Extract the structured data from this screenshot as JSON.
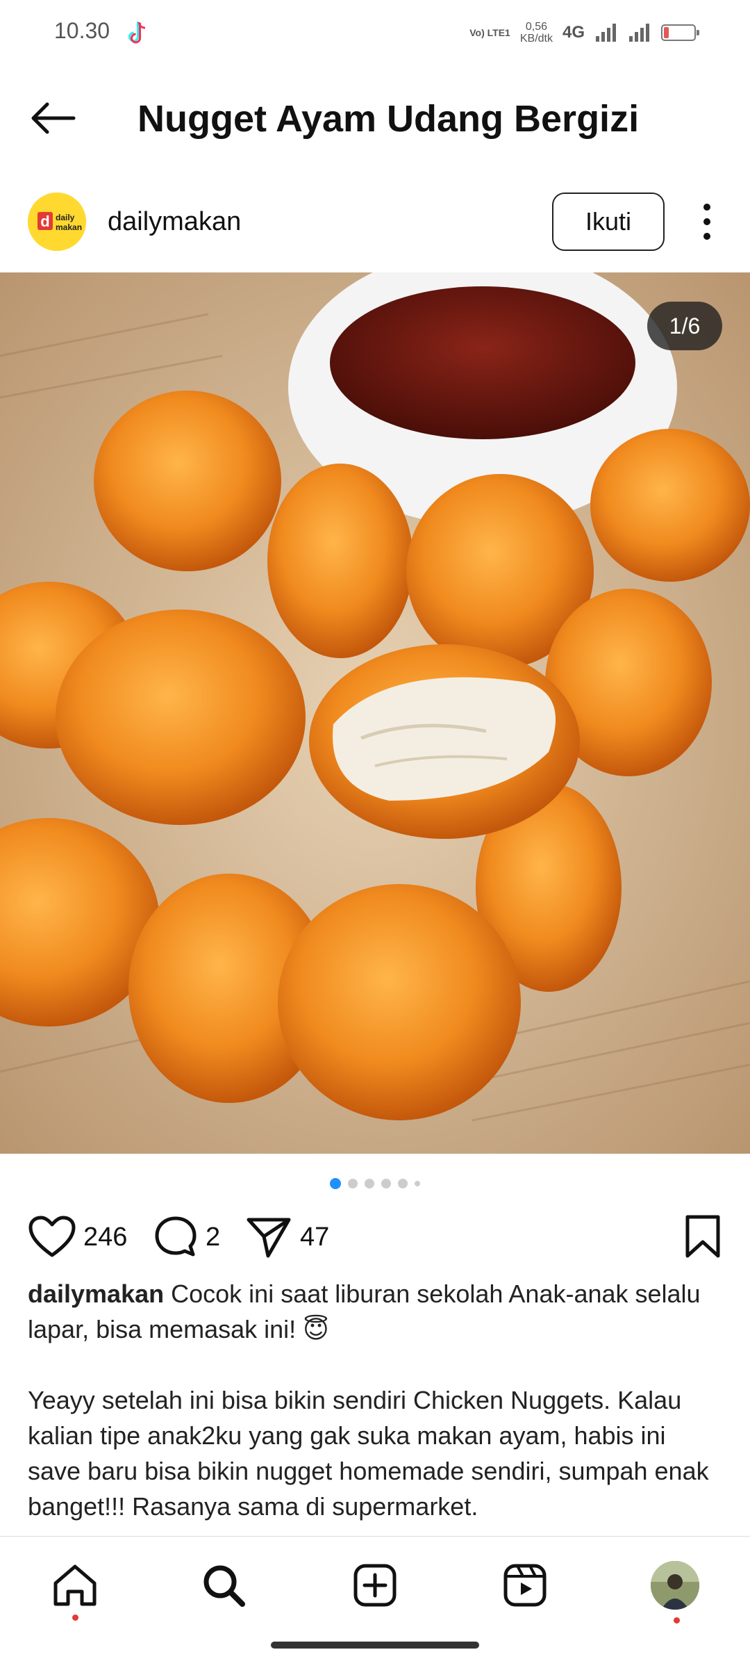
{
  "status": {
    "time": "10.30",
    "volte": "Vo) LTE1",
    "net_speed_value": "0,56",
    "net_speed_unit": "KB/dtk",
    "network": "4G",
    "battery": "17",
    "battery_level": 0.17,
    "battery_color": "#e25757"
  },
  "appbar": {
    "title": "Nugget Ayam Udang Bergizi"
  },
  "post": {
    "username": "dailymakan",
    "brand_logo_top": "daily",
    "brand_logo_bottom": "makan",
    "follow_label": "Ikuti",
    "carousel_counter": "1/6",
    "carousel_current": 1,
    "carousel_total": 6,
    "likes": "246",
    "comments": "2",
    "shares": "47"
  },
  "caption": {
    "username": "dailymakan",
    "line1": "Cocok ini saat liburan sekolah Anak-anak selalu lapar, bisa memasak ini! 😇",
    "line2": "Yeayy setelah ini bisa bikin sendiri Chicken Nuggets. Kalau kalian tipe anak2ku yang gak suka makan ayam, habis ini save baru bisa bikin nugget homemade sendiri, sumpah enak banget!!! Rasanya sama di supermarket."
  },
  "nav": {
    "items": [
      "home-icon",
      "search-icon",
      "create-icon",
      "reels-icon",
      "profile-avatar"
    ]
  },
  "colors": {
    "accent": "#1e90ff",
    "notification": "#e53935"
  }
}
